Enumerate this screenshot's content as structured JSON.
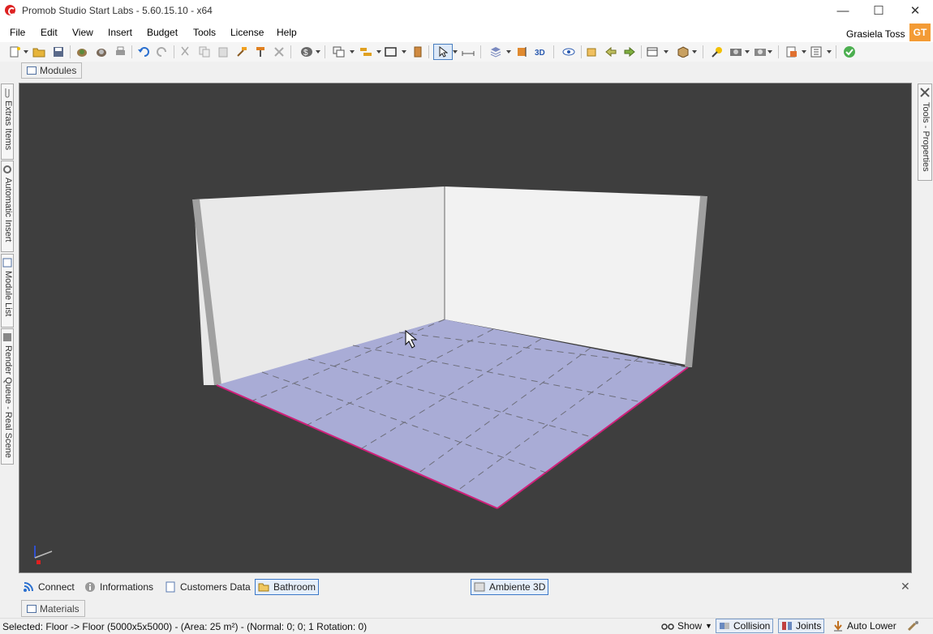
{
  "window": {
    "title": "Promob Studio Start Labs - 5.60.15.10 - x64",
    "min": "—",
    "max": "☐",
    "close": "✕"
  },
  "menu": {
    "items": [
      "File",
      "Edit",
      "View",
      "Insert",
      "Budget",
      "Tools",
      "License",
      "Help"
    ],
    "user_name": "Grasiela Toss",
    "user_initials": "GT"
  },
  "tabs": {
    "modules": "Modules",
    "materials": "Materials"
  },
  "side_left": [
    "Extras Items",
    "Automatic Insert",
    "Module List",
    "Render Queue - Real Scene"
  ],
  "side_right": "Tools - Properties",
  "bottom_tabs": {
    "connect": "Connect",
    "informations": "Informations",
    "customers": "Customers Data",
    "bathroom": "Bathroom",
    "ambiente": "Ambiente 3D"
  },
  "status": {
    "text": "Selected: Floor -> Floor (5000x5x5000) - (Area: 25 m²) - (Normal: 0; 0; 1 Rotation: 0)",
    "show": "Show",
    "collision": "Collision",
    "joints": "Joints",
    "auto_lower": "Auto Lower"
  },
  "colors": {
    "viewport_bg": "#3e3e3e",
    "floor": "#a9acd6",
    "accent": "#3b78c8",
    "badge": "#f39b35"
  }
}
